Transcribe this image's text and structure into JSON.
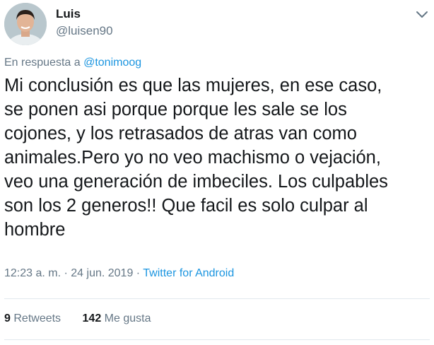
{
  "user": {
    "name": "Luis",
    "handle": "@luisen90",
    "avatar_icon": "profile-photo"
  },
  "reply": {
    "prefix": "En respuesta a ",
    "mention": "@tonimoog"
  },
  "tweet": {
    "text": "Mi conclusión es que las mujeres, en ese caso,\nse ponen asi porque porque les sale se los\ncojones, y los retrasados de atras van como\nanimales.Pero yo no veo machismo o vejación,\nveo una generación de imbeciles. Los culpables\nson los 2 generos!! Que facil es solo culpar al\nhombre"
  },
  "meta": {
    "time": "12:23 a. m.",
    "separator": " · ",
    "date": "24 jun. 2019",
    "source": "Twitter for Android"
  },
  "stats": {
    "retweets_count": "9",
    "retweets_label": "Retweets",
    "likes_count": "142",
    "likes_label": "Me gusta"
  },
  "colors": {
    "link": "#1b95e0",
    "secondary_text": "#657786",
    "primary_text": "#14171a",
    "divider": "#e1e8ed"
  }
}
